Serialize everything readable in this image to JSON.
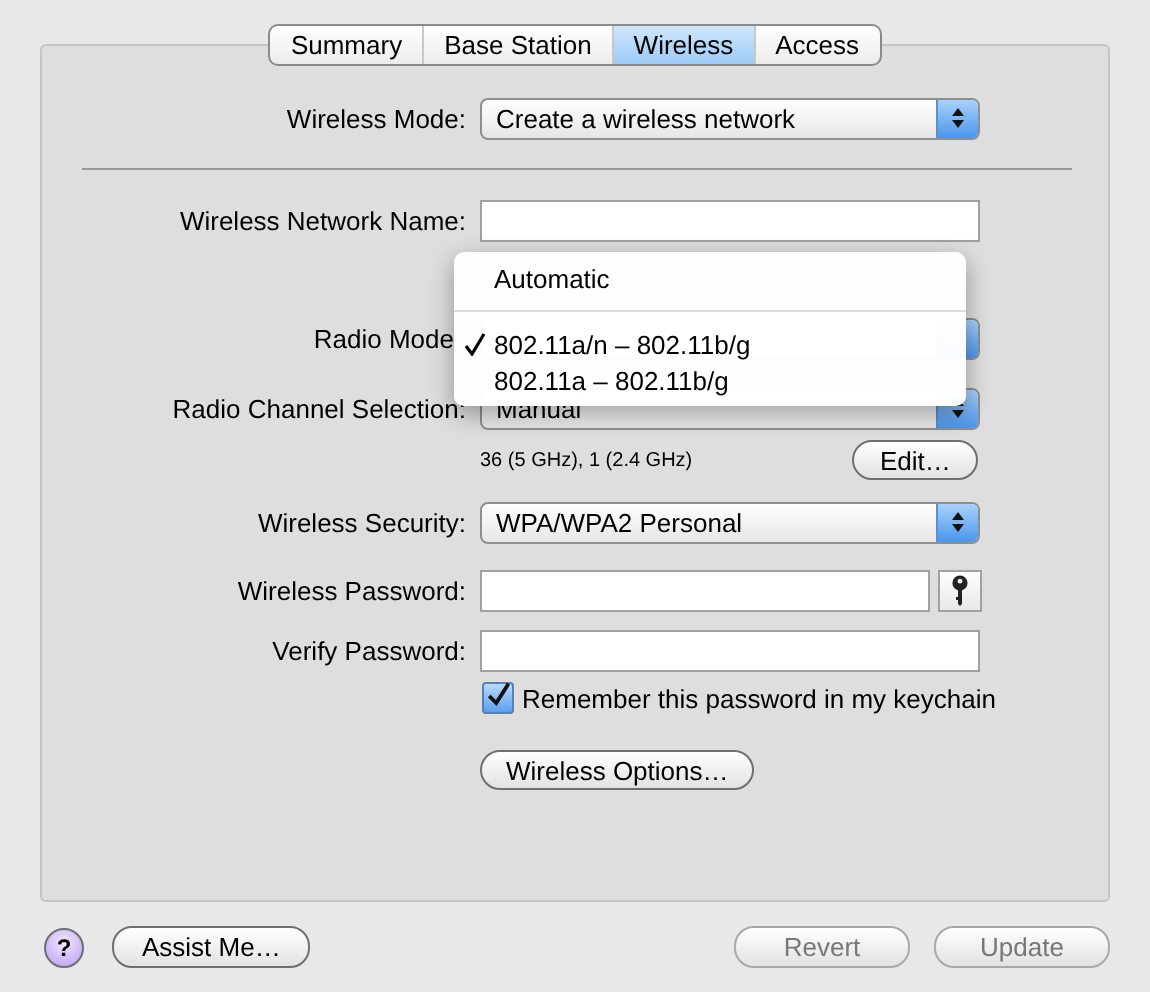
{
  "tabs": [
    {
      "label": "Summary",
      "selected": false
    },
    {
      "label": "Base Station",
      "selected": false
    },
    {
      "label": "Wireless",
      "selected": true
    },
    {
      "label": "Access",
      "selected": false
    }
  ],
  "wireless_mode": {
    "label": "Wireless Mode:",
    "value": "Create a wireless network"
  },
  "network_name": {
    "label": "Wireless Network Name:"
  },
  "radio_mode": {
    "label": "Radio Mode"
  },
  "radio_channel": {
    "label": "Radio Channel Selection:",
    "value": "Manual",
    "info": "36 (5 GHz), 1 (2.4 GHz)",
    "button": "Edit…"
  },
  "wireless_security": {
    "label": "Wireless Security:",
    "value": "WPA/WPA2 Personal"
  },
  "wireless_password": {
    "label": "Wireless Password:"
  },
  "verify_password": {
    "label": "Verify Password:"
  },
  "remember": {
    "label": "Remember this password in my keychain",
    "checked": true
  },
  "options_button": "Wireless Options…",
  "radio_mode_menu": {
    "items": [
      {
        "kind": "option",
        "label": "Automatic",
        "selected": false
      },
      {
        "kind": "separator"
      },
      {
        "kind": "option",
        "label": "802.11a/n – 802.11b/g",
        "selected": true
      },
      {
        "kind": "option",
        "label": "802.11a – 802.11b/g",
        "selected": false
      }
    ]
  },
  "footer": {
    "help": "?",
    "assist": {
      "label": "Assist Me…",
      "disabled": false
    },
    "revert": {
      "label": "Revert",
      "disabled": true
    },
    "update": {
      "label": "Update",
      "disabled": true
    }
  }
}
